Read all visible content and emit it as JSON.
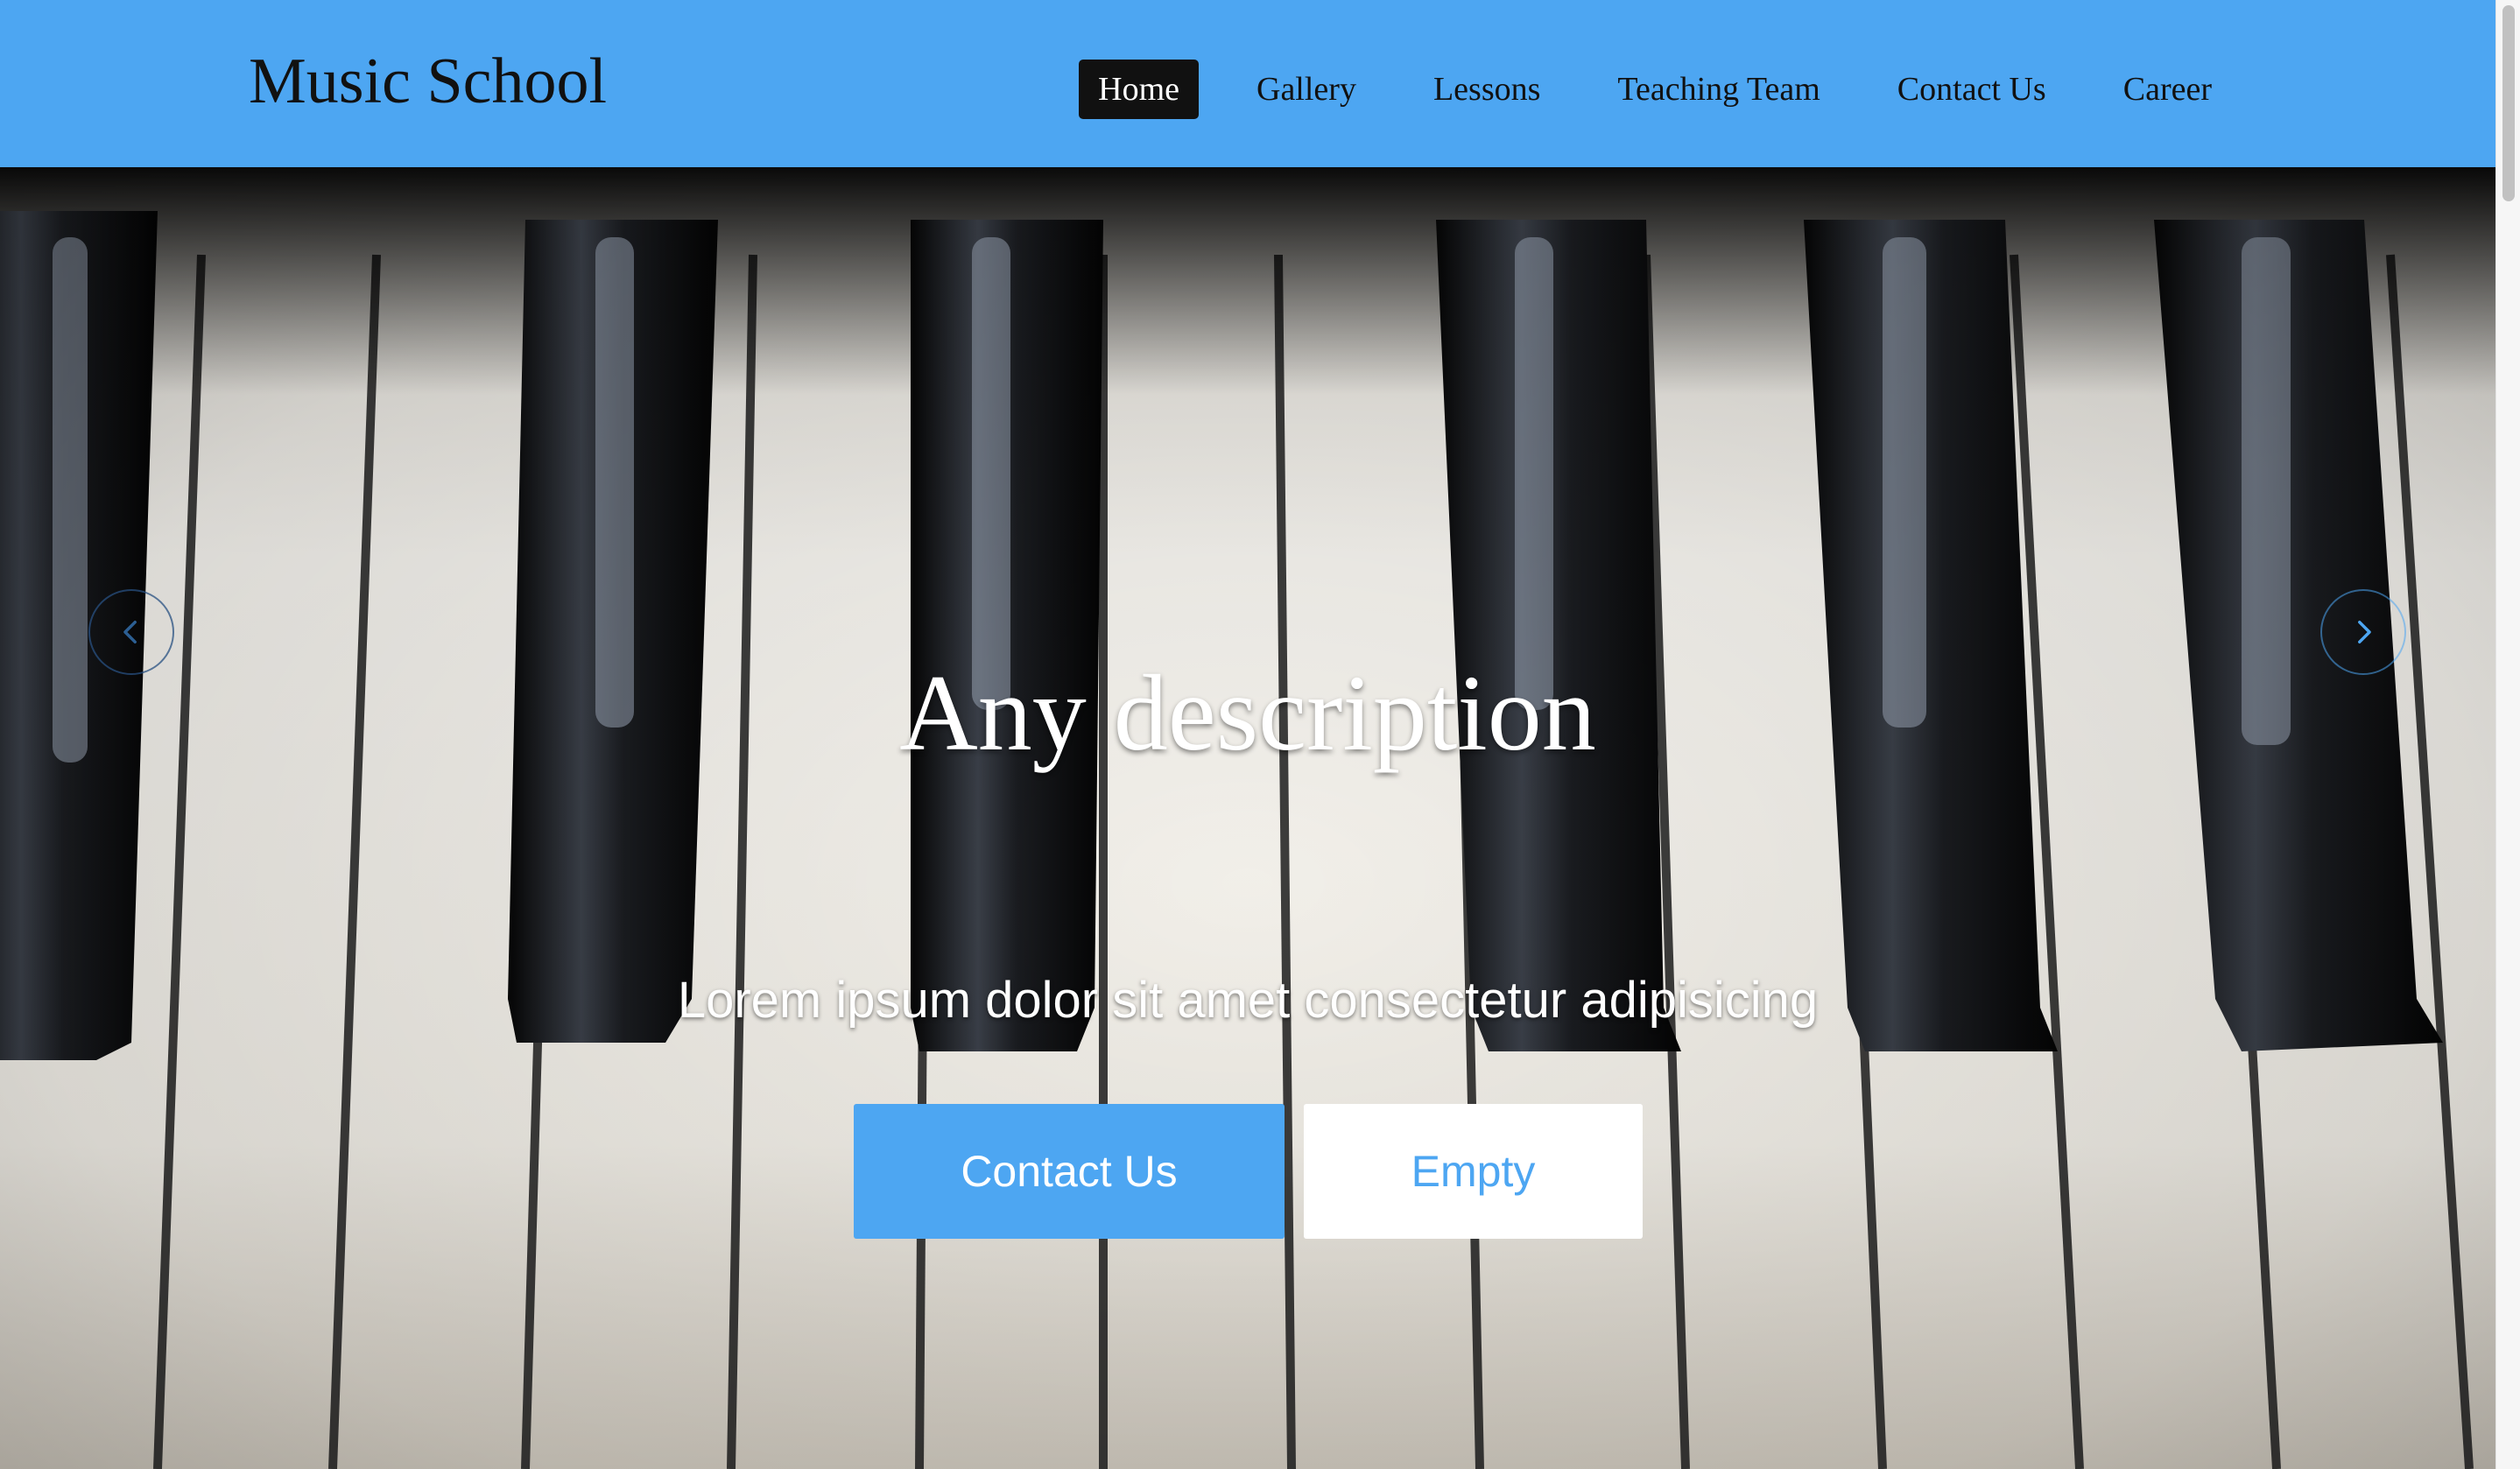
{
  "header": {
    "brand": "Music School",
    "nav": [
      {
        "label": "Home",
        "active": true
      },
      {
        "label": "Gallery",
        "active": false
      },
      {
        "label": "Lessons",
        "active": false
      },
      {
        "label": "Teaching Team",
        "active": false
      },
      {
        "label": "Contact Us",
        "active": false
      },
      {
        "label": "Career",
        "active": false
      }
    ]
  },
  "hero": {
    "title": "Any description",
    "subtitle": "Lorem ipsum dolor sit amet consectetur adipisicing",
    "primary_button": "Contact Us",
    "secondary_button": "Empty",
    "prev_icon": "chevron-left-icon",
    "next_icon": "chevron-right-icon",
    "background": "piano-keys-photo"
  },
  "colors": {
    "header_bg": "#4da6f2",
    "accent": "#4da6f2",
    "active_nav_bg": "#111111",
    "text_dark": "#111111",
    "text_light": "#ffffff"
  }
}
